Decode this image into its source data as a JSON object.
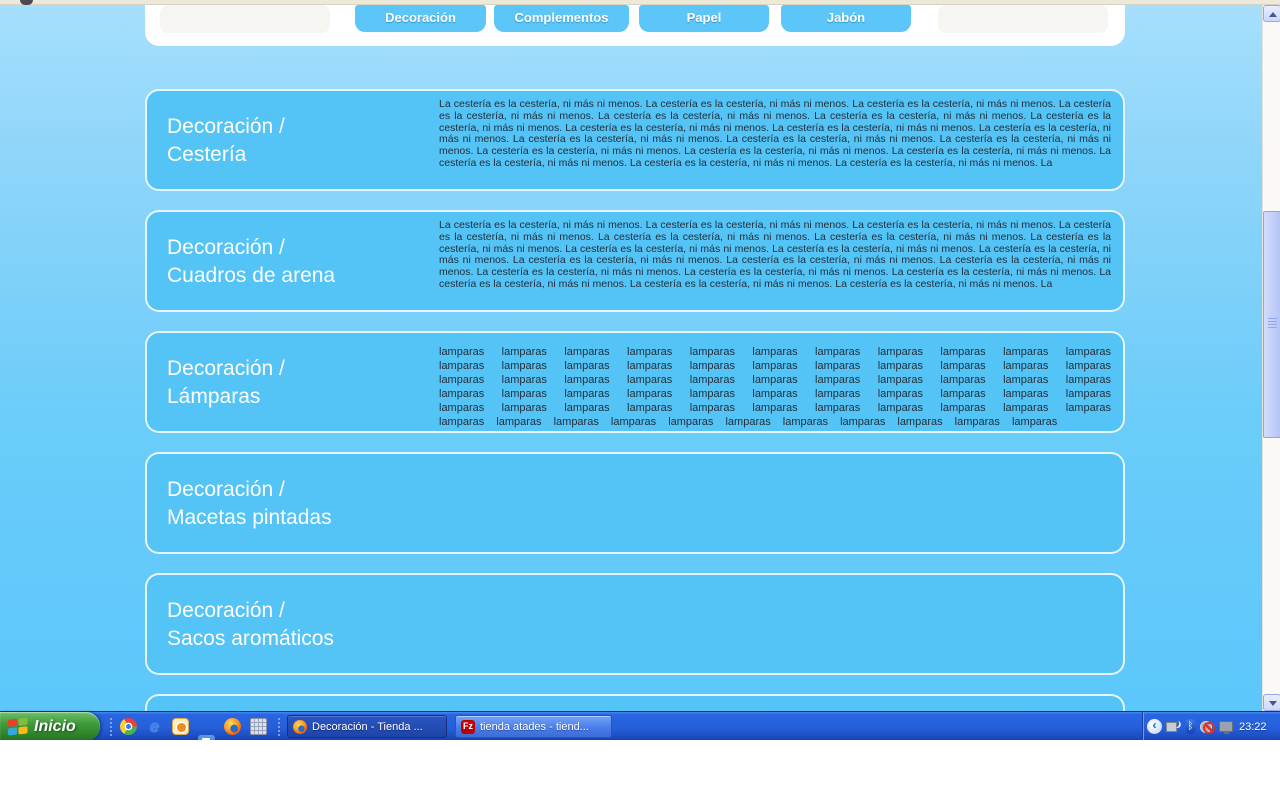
{
  "nav": {
    "buttons": [
      {
        "label": "Decoración"
      },
      {
        "label": "Complementos"
      },
      {
        "label": "Papel"
      },
      {
        "label": "Jabón"
      }
    ]
  },
  "sections": [
    {
      "title1": "Decoración /",
      "title2": "Cestería",
      "body": "La cestería es la cestería, ni más ni menos. La cestería es la cestería, ni más ni menos. La cestería es la cestería, ni más ni menos. La cestería es la cestería, ni más ni menos. La cestería es la cestería, ni más ni menos. La cestería es la cestería, ni más ni menos. La cestería es la cestería, ni más ni menos. La cestería es la cestería, ni más ni menos. La cestería es la cestería, ni más ni menos. La cestería es la cestería, ni más ni menos. La cestería es la cestería, ni más ni menos. La cestería es la cestería, ni más ni menos. La cestería es la cestería, ni más ni menos. La cestería es la cestería, ni más ni menos. La cestería es la cestería, ni más ni menos. La cestería es la cestería, ni más ni menos. La cestería es la cestería, ni más ni menos. La cestería es la cestería, ni más ni menos. La cestería es la cestería, ni más ni menos. La"
    },
    {
      "title1": "Decoración /",
      "title2": "Cuadros de arena",
      "body": "La cestería es la cestería, ni más ni menos. La cestería es la cestería, ni más ni menos. La cestería es la cestería, ni más ni menos. La cestería es la cestería, ni más ni menos. La cestería es la cestería, ni más ni menos. La cestería es la cestería, ni más ni menos. La cestería es la cestería, ni más ni menos. La cestería es la cestería, ni más ni menos. La cestería es la cestería, ni más ni menos. La cestería es la cestería, ni más ni menos. La cestería es la cestería, ni más ni menos. La cestería es la cestería, ni más ni menos. La cestería es la cestería, ni más ni menos. La cestería es la cestería, ni más ni menos. La cestería es la cestería, ni más ni menos. La cestería es la cestería, ni más ni menos. La cestería es la cestería, ni más ni menos. La cestería es la cestería, ni más ni menos. La cestería es la cestería, ni más ni menos. La"
    },
    {
      "title1": "Decoración /",
      "title2": "Lámparas",
      "body": "lamparas lamparas lamparas lamparas lamparas lamparas lamparas lamparas lamparas lamparas lamparas lamparas lamparas lamparas lamparas lamparas lamparas lamparas lamparas lamparas lamparas lamparas lamparas lamparas lamparas lamparas lamparas lamparas lamparas lamparas lamparas lamparas lamparas lamparas lamparas lamparas lamparas lamparas lamparas lamparas lamparas lamparas lamparas lamparas lamparas lamparas lamparas lamparas lamparas lamparas lamparas lamparas lamparas lamparas lamparas lamparas lamparas lamparas lamparas lamparas lamparas lamparas lamparas lamparas lamparas lamparas"
    },
    {
      "title1": "Decoración /",
      "title2": "Macetas pintadas",
      "body": ""
    },
    {
      "title1": "Decoración /",
      "title2": "Sacos aromáticos",
      "body": ""
    },
    {
      "title1": "",
      "title2": "",
      "body": ""
    }
  ],
  "taskbar": {
    "start_label": "Inicio",
    "quick_launch_icons": [
      "chrome-icon",
      "ie-icon",
      "mail-icon",
      "explorer-icon",
      "firefox-icon",
      "calculator-icon"
    ],
    "windows": [
      {
        "label": "Decoración - Tienda ...",
        "icon": "firefox-icon",
        "state": "active"
      },
      {
        "label": "tienda atades - tiend...",
        "icon": "filezilla-icon",
        "state": "inactive"
      }
    ],
    "tray": {
      "icons": [
        "collapse-chevron-icon",
        "network-icon",
        "bluetooth-icon",
        "blocked-device-icon",
        "display-icon"
      ],
      "clock": "23:22"
    }
  },
  "icons": {
    "ie_glyph": "e",
    "filezilla_glyph": "Fz",
    "bluetooth_glyph": "ᛒ",
    "chevron_glyph": "‹"
  },
  "colors": {
    "page_gradient_top": "#a6dffc",
    "page_gradient_bottom": "#5cc7fb",
    "card_blue": "#54c3f6",
    "nav_button_blue": "#5bc6f7",
    "taskbar_blue": "#2560da",
    "start_green": "#3f9c3a",
    "active_task_button": "#1d44a8",
    "inactive_task_button": "#4a7ee8",
    "chrome_strip": "#ece9d8"
  }
}
